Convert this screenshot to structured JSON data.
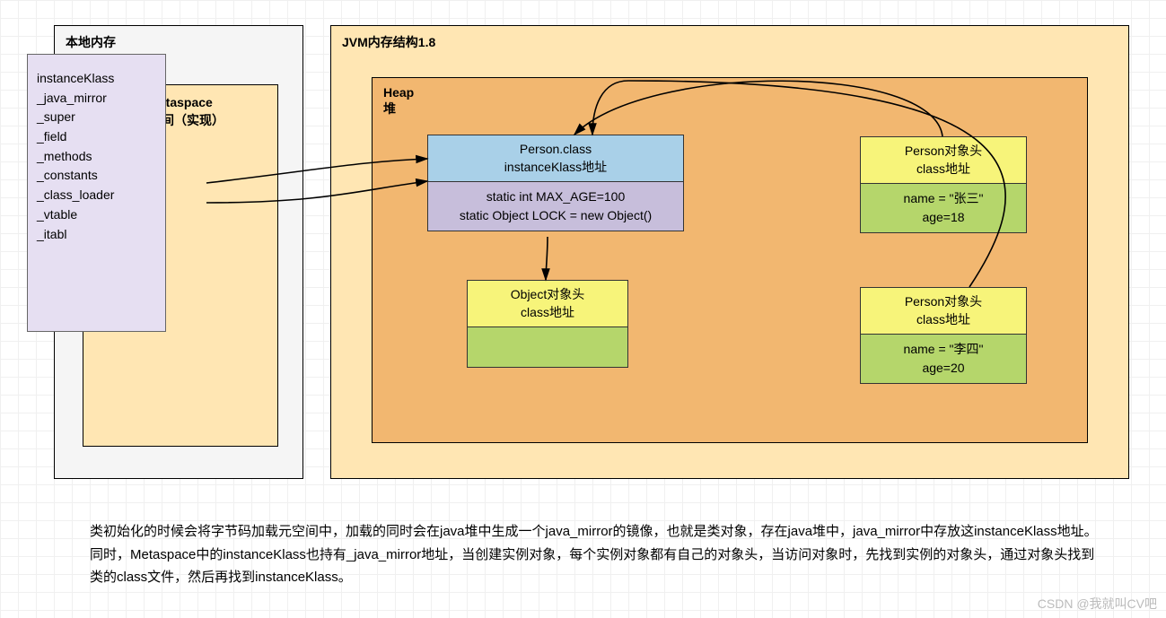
{
  "native": {
    "title": "本地内存",
    "metaspace_title_1": "Metaspace",
    "metaspace_title_2": "元空间（实现）",
    "fields": [
      "instanceKlass",
      "_java_mirror",
      "_super",
      "_field",
      "_methods",
      "_constants",
      "_class_loader",
      "_vtable",
      "_itabl"
    ]
  },
  "jvm": {
    "title": "JVM内存结构1.8",
    "heap_title_1": "Heap",
    "heap_title_2": "堆",
    "person_class": {
      "line1": "Person.class",
      "line2": "instanceKlass地址",
      "static1": "static int MAX_AGE=100",
      "static2": "static Object LOCK = new Object()"
    },
    "object_inst": {
      "head1": "Object对象头",
      "head2": "class地址"
    },
    "person1": {
      "head1": "Person对象头",
      "head2": "class地址",
      "body1": "name = \"张三\"",
      "body2": "age=18"
    },
    "person2": {
      "head1": "Person对象头",
      "head2": "class地址",
      "body1": "name = \"李四\"",
      "body2": "age=20"
    }
  },
  "description": "类初始化的时候会将字节码加载元空间中，加载的同时会在java堆中生成一个java_mirror的镜像，也就是类对象，存在java堆中，java_mirror中存放这instanceKlass地址。同时，Metaspace中的instanceKlass也持有_java_mirror地址，当创建实例对象，每个实例对象都有自己的对象头，当访问对象时，先找到实例的对象头，通过对象头找到类的class文件，然后再找到instanceKlass。",
  "watermark": "CSDN @我就叫CV吧"
}
